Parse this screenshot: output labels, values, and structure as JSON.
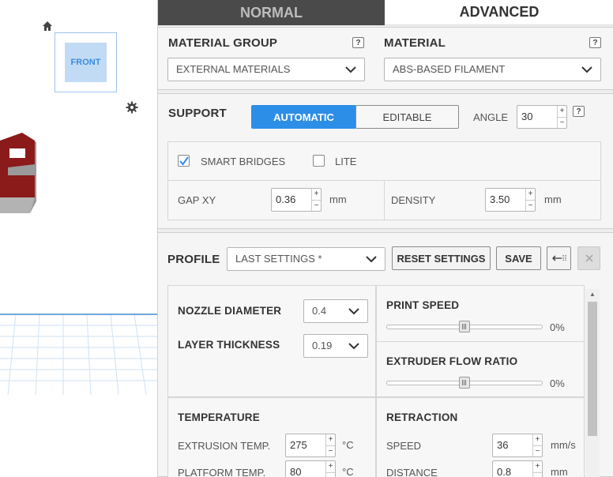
{
  "viewport": {
    "view_cube_face": "FRONT",
    "icons": {
      "home": "home-icon",
      "settings": "gear-icon"
    },
    "model_color": "#8b1a1a"
  },
  "tabs": [
    {
      "label": "NORMAL",
      "active": false
    },
    {
      "label": "ADVANCED",
      "active": true
    }
  ],
  "material": {
    "group_label": "MATERIAL GROUP",
    "group_value": "EXTERNAL MATERIALS",
    "material_label": "MATERIAL",
    "material_value": "ABS-BASED FILAMENT",
    "help": "?"
  },
  "support": {
    "label": "SUPPORT",
    "mode_automatic": "AUTOMATIC",
    "mode_editable": "EDITABLE",
    "active_mode": "AUTOMATIC",
    "angle_label": "ANGLE",
    "angle_value": "30",
    "help": "?",
    "smart_bridges_label": "SMART BRIDGES",
    "smart_bridges_checked": true,
    "lite_label": "LITE",
    "lite_checked": false,
    "gap_xy_label": "GAP XY",
    "gap_xy_value": "0.36",
    "gap_xy_unit": "mm",
    "density_label": "DENSITY",
    "density_value": "3.50",
    "density_unit": "mm"
  },
  "profile": {
    "label": "PROFILE",
    "value": "LAST SETTINGS *",
    "reset_label": "RESET SETTINGS",
    "save_label": "SAVE",
    "icons": {
      "export": "export-icon",
      "close": "close-icon"
    },
    "nozzle_diameter_label": "NOZZLE DIAMETER",
    "nozzle_diameter_value": "0.4",
    "layer_thickness_label": "LAYER THICKNESS",
    "layer_thickness_value": "0.19",
    "print_speed_label": "PRINT SPEED",
    "print_speed_value": "0%",
    "print_speed_level": 0.5,
    "flow_ratio_label": "EXTRUDER FLOW RATIO",
    "flow_ratio_value": "0%",
    "flow_ratio_level": 0.5,
    "temperature_label": "TEMPERATURE",
    "extrusion_temp_label": "EXTRUSION TEMP.",
    "extrusion_temp_value": "275",
    "extrusion_temp_unit": "°C",
    "platform_temp_label": "PLATFORM TEMP.",
    "platform_temp_value": "80",
    "platform_temp_unit": "°C",
    "retraction_label": "RETRACTION",
    "speed_label": "SPEED",
    "speed_value": "36",
    "speed_unit": "mm/s",
    "distance_label": "DISTANCE",
    "distance_value": "0.8",
    "distance_unit": "mm"
  },
  "colors": {
    "accent": "#2d8ee8",
    "tab_dark": "#4a4a4a",
    "panel_bg": "#eeeeee"
  }
}
